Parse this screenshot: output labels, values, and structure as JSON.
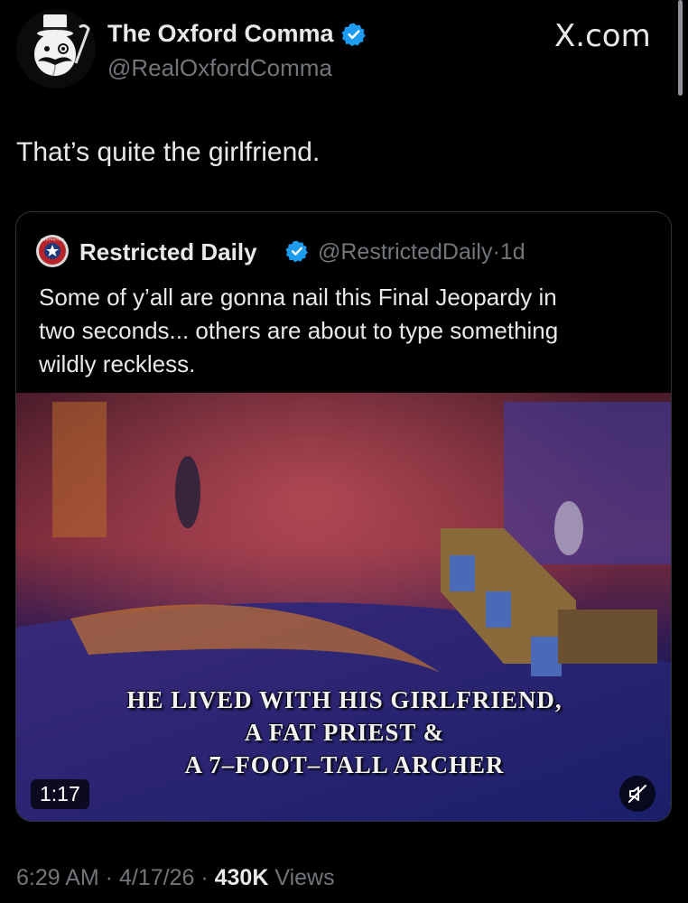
{
  "author": {
    "name": "The Oxford Comma",
    "handle": "@RealOxfordComma",
    "avatar_icon": "mustache-top-hat-avatar-icon",
    "verified_icon": "verified-badge-icon"
  },
  "brand": "X.com",
  "tweet": {
    "text": "That’s quite the girlfriend."
  },
  "quote": {
    "name": "Restricted Daily",
    "handle": "@RestrictedDaily",
    "separator": "·",
    "age": "1d",
    "text_lines": [
      "Some of y’all are gonna nail this Final Jeopardy in",
      "two seconds... others are about to type something",
      "wildly reckless."
    ],
    "avatar_text": "RESTRICTED",
    "media": {
      "caption_lines": [
        "HE LIVED WITH HIS GIRLFRIEND,",
        "A FAT PRIEST &",
        "A 7–FOOT–TALL ARCHER"
      ],
      "duration": "1:17",
      "mute_icon": "muted-speaker-icon"
    }
  },
  "footer": {
    "time": "6:29 AM",
    "dot1": "·",
    "date": "4/17/26",
    "dot2": "·",
    "views_count": "430K",
    "views_label": "Views"
  },
  "colors": {
    "background": "#000000",
    "primary_text": "#e7e9ea",
    "secondary_text": "#71767b",
    "verified_blue": "#1d9bf0",
    "card_border": "#2f3336"
  }
}
